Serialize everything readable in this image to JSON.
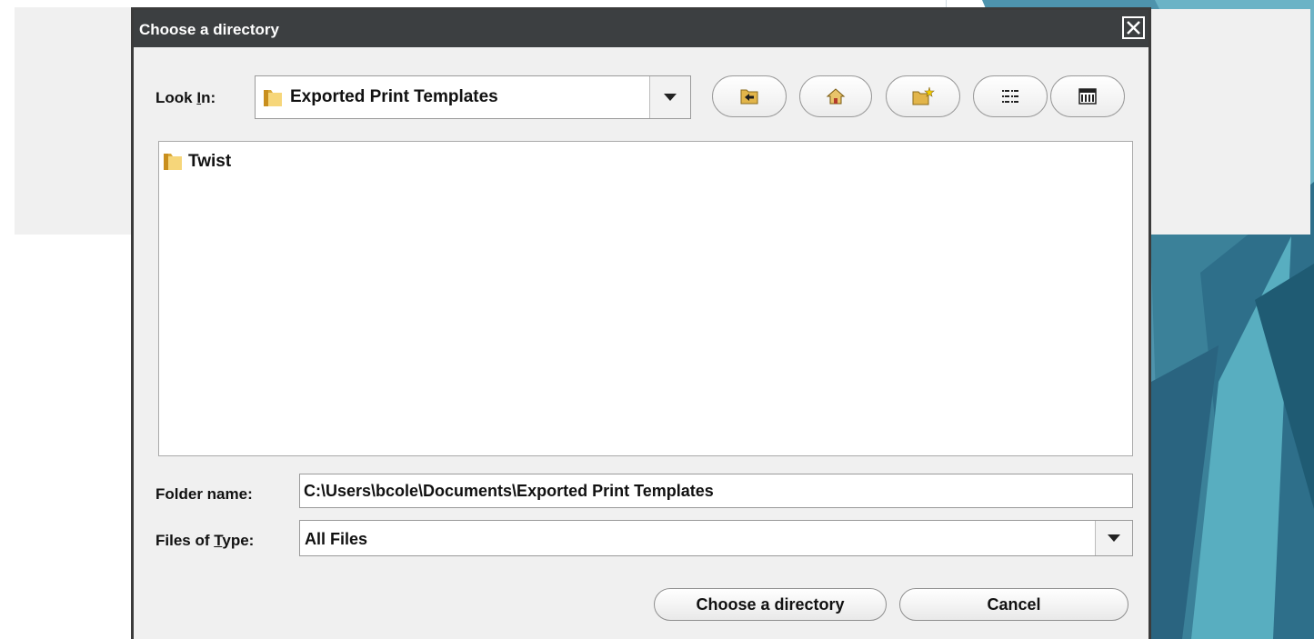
{
  "dialog": {
    "title": "Choose a directory"
  },
  "look_in": {
    "label_prefix": "Look ",
    "label_mnemonic": "I",
    "label_suffix": "n:",
    "value": "Exported Print Templates"
  },
  "toolbar": {
    "icons": [
      "up-one-level-icon",
      "home-icon",
      "new-folder-icon",
      "list-view-icon",
      "details-view-icon"
    ]
  },
  "file_list": {
    "items": [
      {
        "name": "Twist",
        "type": "folder"
      }
    ]
  },
  "folder_name": {
    "label": "Folder name:",
    "value": "C:\\Users\\bcole\\Documents\\Exported Print Templates"
  },
  "files_of_type": {
    "label_prefix": "Files of ",
    "label_mnemonic": "T",
    "label_suffix": "ype:",
    "value": "All Files"
  },
  "buttons": {
    "choose_label": "Choose a directory",
    "cancel_label": "Cancel"
  },
  "colors": {
    "titlebar": "#3c3f41",
    "dialog_bg": "#f0f0f0",
    "background_art": "#2f7f9a"
  }
}
